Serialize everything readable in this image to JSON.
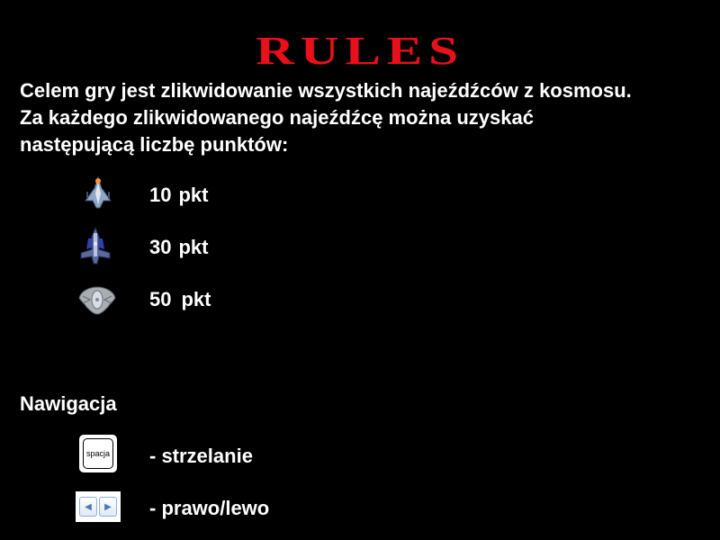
{
  "title": "RULES",
  "intro": {
    "line1": "Celem gry jest zlikwidowanie wszystkich najeźdźców z kosmosu.",
    "line2": "Za każdego zlikwidowanego najeźdźcę można uzyskać",
    "line3": "następującą liczbę punktów:"
  },
  "enemies": [
    {
      "points": "10",
      "unit": "pkt",
      "icon": "small-fighter-ship-icon"
    },
    {
      "points": "30",
      "unit": "pkt",
      "icon": "blue-fighter-ship-icon"
    },
    {
      "points": "50",
      "unit": "pkt",
      "icon": "winged-saucer-ship-icon"
    }
  ],
  "navigation": {
    "heading": "Nawigacja",
    "space_key_label": "spacja",
    "shoot_text": "- strzelanie",
    "move_text": "- prawo/lewo"
  },
  "colors": {
    "background": "#000000",
    "title": "#e8101a",
    "text": "#ffffff"
  }
}
